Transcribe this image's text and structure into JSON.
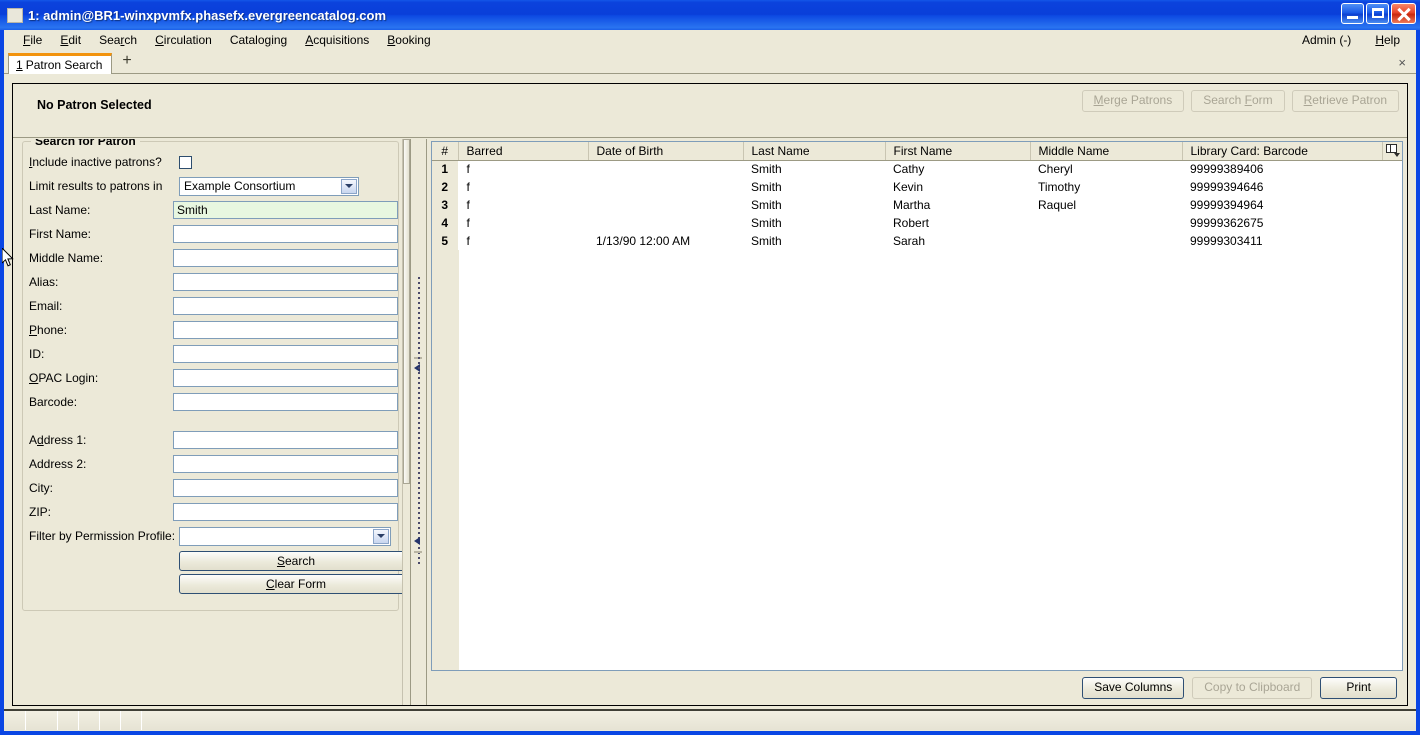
{
  "window": {
    "title": "1: admin@BR1-winxpvmfx.phasefx.evergreencatalog.com",
    "minimize_label": "Minimize",
    "maximize_label": "Maximize",
    "close_label": "Close",
    "titlebar_color": "#0a3fd9"
  },
  "menubar": {
    "items": [
      {
        "label": "File",
        "accel": "F"
      },
      {
        "label": "Edit",
        "accel": "E"
      },
      {
        "label": "Search",
        "accel": "r"
      },
      {
        "label": "Circulation",
        "accel": "C"
      },
      {
        "label": "Cataloging",
        "accel": "g"
      },
      {
        "label": "Acquisitions",
        "accel": "A"
      },
      {
        "label": "Booking",
        "accel": "B"
      }
    ],
    "right_items": [
      {
        "label": "Admin (-)"
      },
      {
        "label": "Help"
      }
    ]
  },
  "tabs": {
    "items": [
      {
        "number": "1",
        "label": "Patron Search",
        "active": true
      }
    ],
    "new_tab_label": "+",
    "close_label": "×"
  },
  "patron_header": {
    "title": "No Patron Selected",
    "buttons": [
      {
        "label": "Merge Patrons",
        "enabled": false
      },
      {
        "label": "Search Form",
        "enabled": false
      },
      {
        "label": "Retrieve Patron",
        "enabled": false
      }
    ]
  },
  "search_form": {
    "legend": "Search for Patron",
    "include_inactive_label": "Include inactive patrons?",
    "include_inactive_checked": false,
    "limit_results_label": "Limit results to patrons in",
    "limit_results_value": "Example Consortium",
    "fields": [
      {
        "label": "Last Name:",
        "value": "Smith",
        "focused": true
      },
      {
        "label": "First Name:",
        "value": "",
        "focused": false
      },
      {
        "label": "Middle Name:",
        "value": "",
        "focused": false
      },
      {
        "label": "Alias:",
        "value": "",
        "focused": false
      },
      {
        "label": "Email:",
        "value": "",
        "focused": false
      },
      {
        "label": "Phone:",
        "value": "",
        "focused": false
      },
      {
        "label": "ID:",
        "value": "",
        "focused": false
      },
      {
        "label": "OPAC Login:",
        "value": "",
        "focused": false
      },
      {
        "label": "Barcode:",
        "value": "",
        "focused": false
      }
    ],
    "address_fields": [
      {
        "label": "Address 1:",
        "value": ""
      },
      {
        "label": "Address 2:",
        "value": ""
      },
      {
        "label": "City:",
        "value": ""
      },
      {
        "label": "ZIP:",
        "value": ""
      }
    ],
    "permission_profile_label": "Filter by Permission Profile:",
    "permission_profile_value": "",
    "search_button": "Search",
    "clear_button": "Clear Form"
  },
  "results": {
    "columns": [
      "#",
      "Barred",
      "Date of Birth",
      "Last Name",
      "First Name",
      "Middle Name",
      "Library Card: Barcode"
    ],
    "column_picker_icon": "column-picker-icon",
    "rows": [
      {
        "num": "1",
        "barred": "f",
        "dob": "",
        "last": "Smith",
        "first": "Cathy",
        "middle": "Cheryl",
        "barcode": "99999389406"
      },
      {
        "num": "2",
        "barred": "f",
        "dob": "",
        "last": "Smith",
        "first": "Kevin",
        "middle": "Timothy",
        "barcode": "99999394646"
      },
      {
        "num": "3",
        "barred": "f",
        "dob": "",
        "last": "Smith",
        "first": "Martha",
        "middle": "Raquel",
        "barcode": "99999394964"
      },
      {
        "num": "4",
        "barred": "f",
        "dob": "",
        "last": "Smith",
        "first": "Robert",
        "middle": "",
        "barcode": "99999362675"
      },
      {
        "num": "5",
        "barred": "f",
        "dob": "1/13/90 12:00 AM",
        "last": "Smith",
        "first": "Sarah",
        "middle": "",
        "barcode": "99999303411"
      }
    ],
    "footer_buttons": [
      {
        "label": "Save Columns",
        "enabled": true
      },
      {
        "label": "Copy to Clipboard",
        "enabled": false
      },
      {
        "label": "Print",
        "enabled": true
      }
    ]
  },
  "statusbar": {
    "cells": [
      "",
      "",
      "",
      "",
      "",
      "",
      ""
    ]
  }
}
